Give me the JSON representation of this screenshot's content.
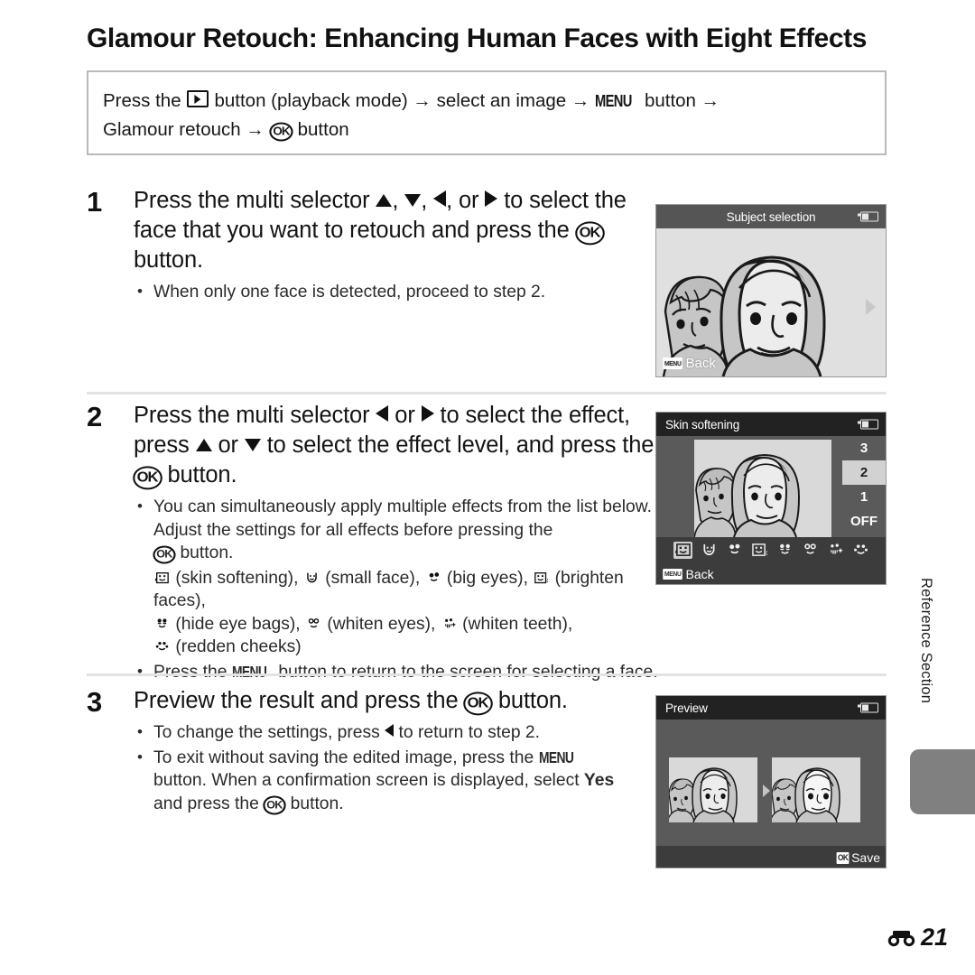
{
  "page": {
    "title": "Glamour Retouch: Enhancing Human Faces with Eight Effects",
    "side_tab_label": "Reference Section",
    "page_number": "21",
    "page_number_prefix_icon": "reference-section-icon"
  },
  "path_box": {
    "line1_a": "Press the",
    "line1_b": "button (playback mode)",
    "line1_c": "select an image",
    "line1_d": "button",
    "line2_a": "Glamour retouch",
    "line2_b": "button",
    "menu_label": "MENU",
    "arrow": "→"
  },
  "steps": [
    {
      "number": "1",
      "heading_a": "Press the multi selector",
      "heading_b": ",",
      "heading_c": ",",
      "heading_d": ", or",
      "heading_e": "to select the face that you want to retouch and press the",
      "heading_f": "button.",
      "bullets": [
        {
          "text": "When only one face is detected, proceed to step 2."
        }
      ]
    },
    {
      "number": "2",
      "heading_a": "Press the multi selector",
      "heading_b": "or",
      "heading_c": "to select the effect, press",
      "heading_d": "or",
      "heading_e": "to select the effect level, and press the",
      "heading_f": "button.",
      "bullets": [
        {
          "text": "You can simultaneously apply multiple effects from the list below. Adjust the settings for all effects before pressing the"
        },
        {
          "text": "button."
        },
        {
          "text": "Press the"
        },
        {
          "text": "button to return to the screen for selecting a face."
        }
      ],
      "effects_list": [
        {
          "icon": "skin-softening-icon",
          "label": "(skin softening),"
        },
        {
          "icon": "small-face-icon",
          "label": "(small face),"
        },
        {
          "icon": "big-eyes-icon",
          "label": "(big eyes),"
        },
        {
          "icon": "brighten-faces-icon",
          "label": "(brighten faces),"
        },
        {
          "icon": "hide-eye-bags-icon",
          "label": "(hide eye bags),"
        },
        {
          "icon": "whiten-eyes-icon",
          "label": "(whiten eyes),"
        },
        {
          "icon": "whiten-teeth-icon",
          "label": "(whiten teeth),"
        },
        {
          "icon": "redden-cheeks-icon",
          "label": "(redden cheeks)"
        }
      ]
    },
    {
      "number": "3",
      "heading_a": "Preview the result and press the",
      "heading_b": "button.",
      "bullets": [
        {
          "text_a": "To change the settings, press",
          "text_b": "to return to step 2."
        },
        {
          "text_a": "To exit without saving the edited image, press the",
          "text_b": "button. When a confirmation screen is displayed, select",
          "bold": "Yes",
          "text_c": "and press the",
          "text_d": "button."
        }
      ]
    }
  ],
  "screens": [
    {
      "name": "subject-selection",
      "title": "Subject selection",
      "footer_label": "Back",
      "footer_chip": "MENU",
      "battery_icon": "battery-icon",
      "right_arrow_icon": "chevron-right-icon"
    },
    {
      "name": "skin-softening",
      "title": "Skin softening",
      "footer_label": "Back",
      "footer_chip": "MENU",
      "battery_icon": "battery-icon",
      "levels": [
        "3",
        "2",
        "1",
        "OFF"
      ],
      "selected_level": "2",
      "effect_icons": [
        "skin-softening-icon",
        "small-face-icon",
        "big-eyes-icon",
        "brighten-faces-icon",
        "hide-eye-bags-icon",
        "whiten-eyes-icon",
        "whiten-teeth-icon",
        "redden-cheeks-icon"
      ],
      "selected_effect_index": 0
    },
    {
      "name": "preview",
      "title": "Preview",
      "footer_label": "Save",
      "footer_chip": "OK",
      "battery_icon": "battery-icon"
    }
  ],
  "colors": {
    "screen_title_dark": "#222222",
    "screen_title_mid": "#555555",
    "screen_body": "#5a5a5a",
    "screen_body_light": "#e0e0e0",
    "photo_bg": "#d9d9d9",
    "toolbar": "#3c3c3c",
    "selected_level_bg": "#d2d2d2",
    "side_tab": "#808080",
    "divider": "#e2e2e2",
    "box_border": "#b9b9b9"
  }
}
